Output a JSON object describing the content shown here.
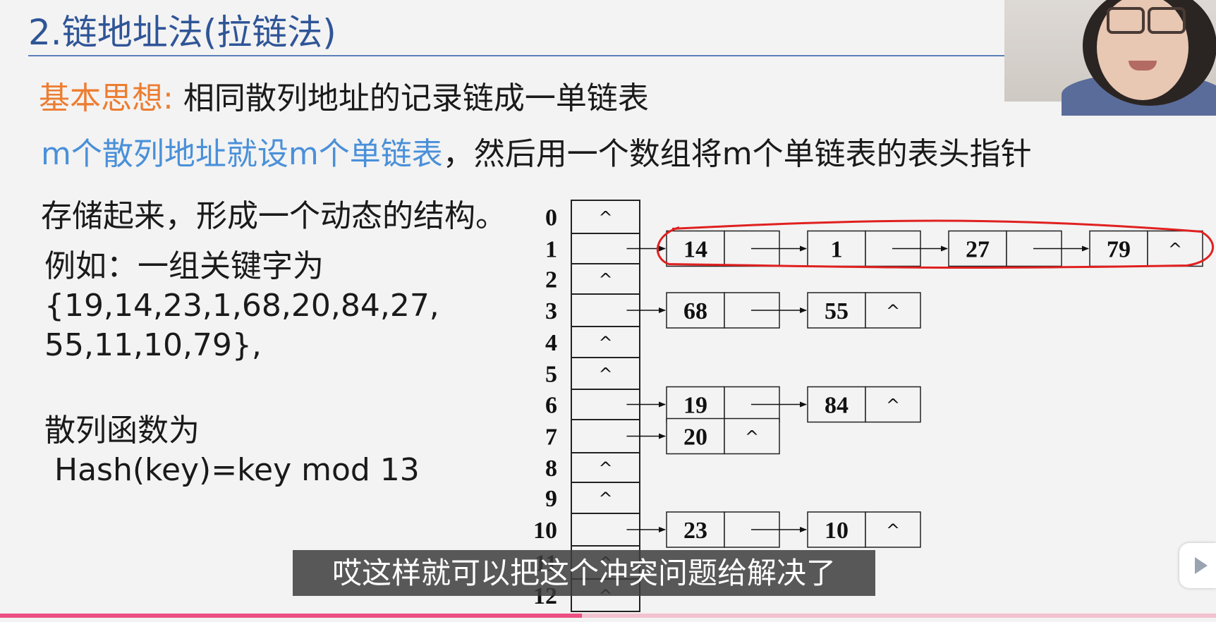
{
  "slide": {
    "title": "2.链地址法(拉链法)",
    "basic_idea_label": "基本思想:",
    "basic_idea_text": "相同散列地址的记录链成一单链表",
    "line2_blue": "m个散列地址就设m个单链表",
    "line2_rest": "，然后用一个数组将m个单链表的表头指针",
    "line3": "存储起来，形成一个动态的结构。",
    "example_title": "例如：一组关键字为",
    "example_keys_line1": "{19,14,23,1,68,20,84,27,",
    "example_keys_line2": "55,11,10,79},",
    "hash_label": "散列函数为",
    "hash_function": "Hash(key)=key mod 13"
  },
  "diagram": {
    "indices": [
      "0",
      "1",
      "2",
      "3",
      "4",
      "5",
      "6",
      "7",
      "8",
      "9",
      "10",
      "11",
      "12"
    ],
    "null_symbol": "^",
    "chains": [
      {
        "slot": "1",
        "nodes": [
          "14",
          "1",
          "27",
          "79"
        ]
      },
      {
        "slot": "3",
        "nodes": [
          "68",
          "55"
        ]
      },
      {
        "slot": "6",
        "nodes": [
          "19",
          "84"
        ]
      },
      {
        "slot": "7",
        "nodes": [
          "20"
        ]
      },
      {
        "slot": "10",
        "nodes": [
          "23",
          "10"
        ]
      }
    ]
  },
  "colors": {
    "title": "#2f5597",
    "orange_label": "#ed7d31",
    "blue_text": "#4a90d9",
    "annotation_red": "#e02020",
    "progress": "#ec4f83"
  },
  "subtitle": "哎这样就可以把这个冲突问题给解决了",
  "icons": [
    "play-icon"
  ]
}
